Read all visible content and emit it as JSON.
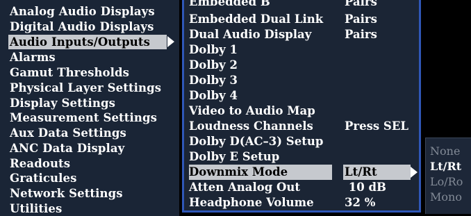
{
  "left_menu": {
    "items": [
      {
        "label": "Analog Audio Displays"
      },
      {
        "label": "Digital Audio Displays"
      },
      {
        "label": "Audio Inputs/Outputs",
        "selected": true
      },
      {
        "label": "Alarms"
      },
      {
        "label": "Gamut Thresholds"
      },
      {
        "label": "Physical Layer Settings"
      },
      {
        "label": "Display Settings"
      },
      {
        "label": "Measurement Settings"
      },
      {
        "label": "Aux Data Settings"
      },
      {
        "label": "ANC Data Display"
      },
      {
        "label": "Readouts"
      },
      {
        "label": "Graticules"
      },
      {
        "label": "Network Settings"
      },
      {
        "label": "Utilities"
      }
    ]
  },
  "submenu": {
    "rows": [
      {
        "label": "Embedded B",
        "value": "Pairs"
      },
      {
        "label": "Embedded Dual Link",
        "value": "Pairs"
      },
      {
        "label": "Dual Audio Display",
        "value": "Pairs"
      },
      {
        "label": "Dolby 1",
        "value": ""
      },
      {
        "label": "Dolby 2",
        "value": ""
      },
      {
        "label": "Dolby 3",
        "value": ""
      },
      {
        "label": "Dolby 4",
        "value": ""
      },
      {
        "label": "Video to Audio Map",
        "value": ""
      },
      {
        "label": "Loudness Channels",
        "value": "Press SEL"
      },
      {
        "label": "Dolby D(AC–3) Setup",
        "value": ""
      },
      {
        "label": "Dolby E Setup",
        "value": ""
      },
      {
        "label": "Downmix Mode",
        "value": "Lt/Rt",
        "selected": true
      },
      {
        "label": "Atten Analog Out",
        "value": " 10 dB"
      },
      {
        "label": "Headphone Volume",
        "value": "32 %"
      }
    ]
  },
  "options": {
    "items": [
      {
        "label": "None",
        "active": false
      },
      {
        "label": "Lt/Rt",
        "active": true
      },
      {
        "label": "Lo/Ro",
        "active": false
      },
      {
        "label": "Mono",
        "active": false
      }
    ]
  },
  "colors": {
    "panel_bg": "#1b2535",
    "border_blue": "#2f57b8",
    "highlight": "#c6c9ce"
  }
}
